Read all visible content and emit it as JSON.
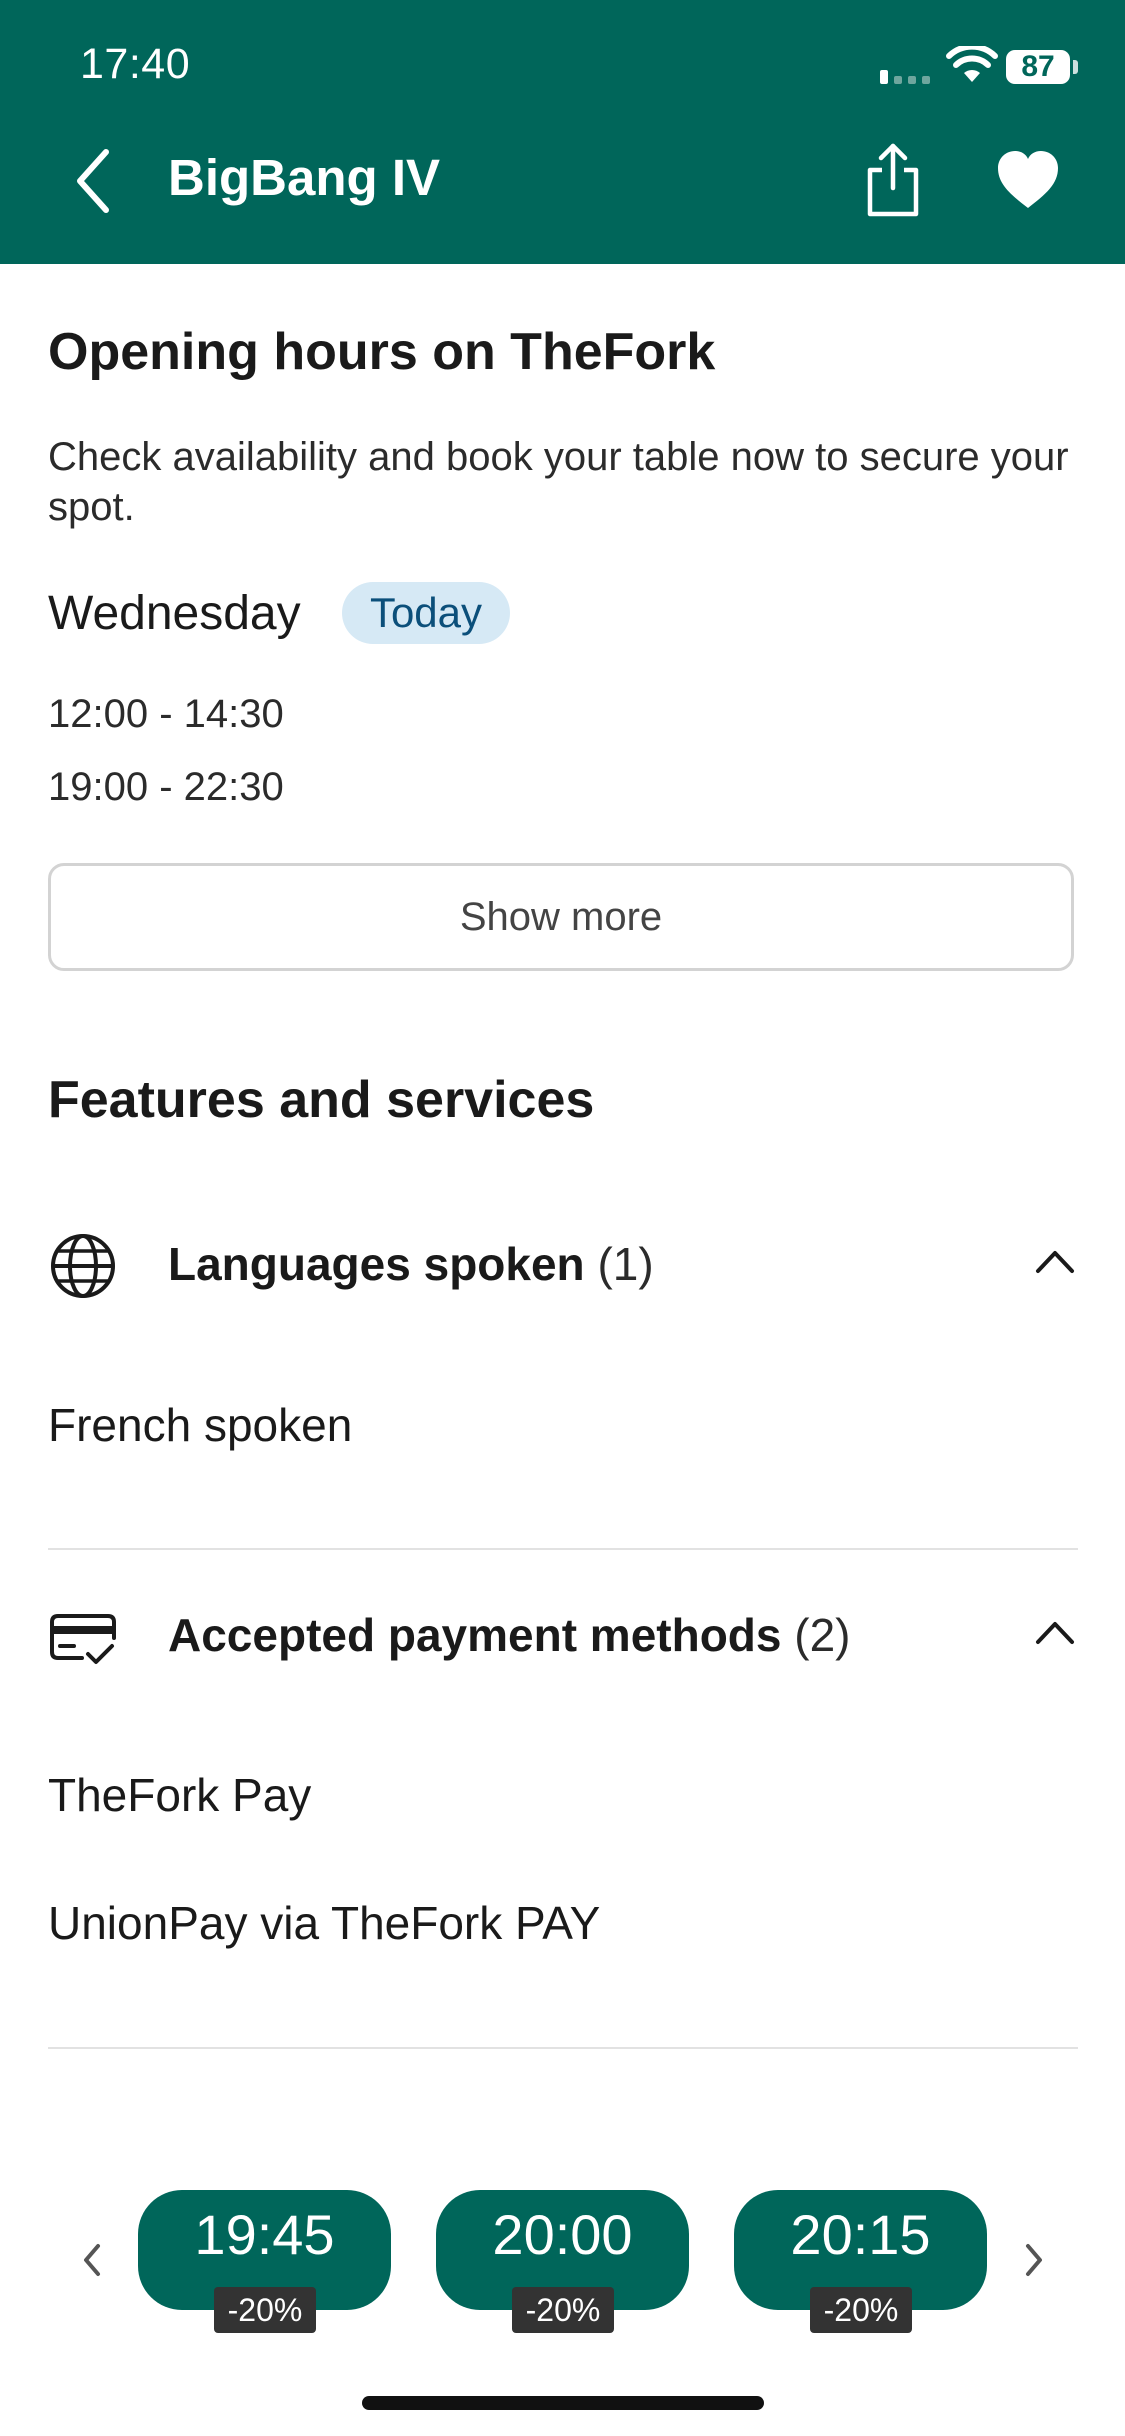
{
  "status_bar": {
    "time": "17:40",
    "battery": "87"
  },
  "nav": {
    "title": "BigBang IV"
  },
  "opening_hours": {
    "heading": "Opening hours on TheFork",
    "description": "Check availability and book your table now to secure your spot.",
    "day": "Wednesday",
    "today_badge": "Today",
    "slots": [
      "12:00 - 14:30",
      "19:00 - 22:30"
    ],
    "show_more_label": "Show more"
  },
  "features": {
    "heading": "Features and services",
    "languages": {
      "label": "Languages spoken",
      "count": "(1)",
      "items": [
        "French spoken"
      ]
    },
    "payments": {
      "label": "Accepted payment methods",
      "count": "(2)",
      "items": [
        "TheFork Pay",
        "UnionPay via TheFork PAY"
      ]
    }
  },
  "booking_bar": {
    "slots": [
      {
        "time": "19:45",
        "discount": "-20%"
      },
      {
        "time": "20:00",
        "discount": "-20%"
      },
      {
        "time": "20:15",
        "discount": "-20%"
      }
    ]
  },
  "colors": {
    "brand": "#00665a",
    "badge_bg": "#d6e9f5",
    "badge_text": "#0b4f7a"
  },
  "icons": [
    "back-icon",
    "share-icon",
    "heart-icon",
    "globe-icon",
    "card-check-icon",
    "chevron-up-icon",
    "chevron-left-icon",
    "chevron-right-icon"
  ]
}
